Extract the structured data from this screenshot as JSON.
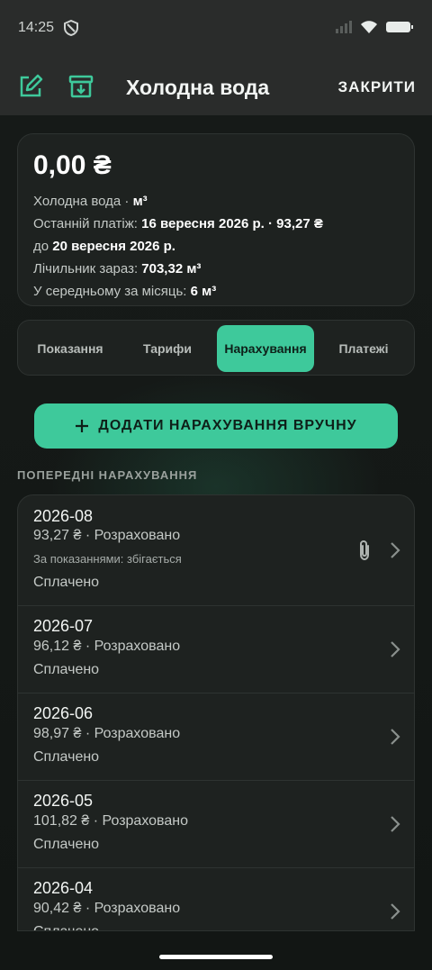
{
  "status": {
    "time": "14:25"
  },
  "appbar": {
    "title": "Холодна вода",
    "close_label": "ЗАКРИТИ",
    "edit_icon": "edit-icon",
    "archive_icon": "archive-icon"
  },
  "summary": {
    "balance": "0,00 ₴",
    "service_prefix": "Холодна вода · ",
    "unit": "м³",
    "last_payment_label": "Останній платіж: ",
    "last_payment_value": "16 вересня 2026 р. · 93,27 ₴",
    "due_prefix": "до ",
    "due_value": "20 вересня 2026 р.",
    "meter_label": "Лічильник зараз: ",
    "meter_value": "703,32 м³",
    "average_label": "У середньому за місяць: ",
    "average_value": "6 м³"
  },
  "tabs": [
    {
      "label": "Показання"
    },
    {
      "label": "Тарифи"
    },
    {
      "label": "Нарахування"
    },
    {
      "label": "Платежі"
    }
  ],
  "active_tab": "Нарахування",
  "add_button": {
    "label": "ДОДАТИ НАРАХУВАННЯ ВРУЧНУ"
  },
  "section_title": "ПОПЕРЕДНІ НАРАХУВАННЯ",
  "charges": [
    {
      "period": "2026-08",
      "amount": "93,27 ₴ · Розраховано",
      "note": "За показаннями: збігається",
      "status": "Сплачено",
      "has_attachment": true
    },
    {
      "period": "2026-07",
      "amount": "96,12 ₴ · Розраховано",
      "status": "Сплачено"
    },
    {
      "period": "2026-06",
      "amount": "98,97 ₴ · Розраховано",
      "status": "Сплачено"
    },
    {
      "period": "2026-05",
      "amount": "101,82 ₴ · Розраховано",
      "status": "Сплачено"
    },
    {
      "period": "2026-04",
      "amount": "90,42 ₴ · Розраховано",
      "status": "Сплачено"
    }
  ],
  "colors": {
    "accent": "#3ec99b",
    "background": "#141816",
    "card": "#1e2220"
  }
}
